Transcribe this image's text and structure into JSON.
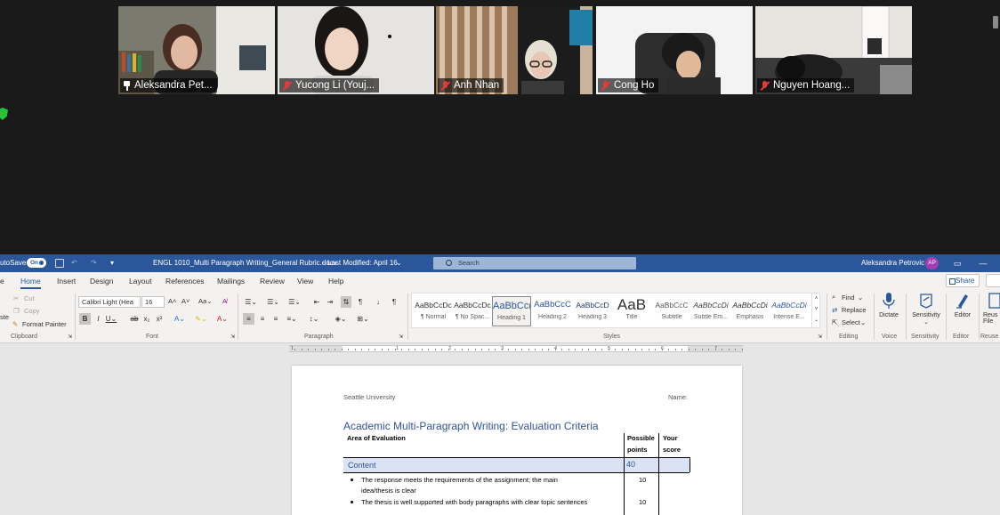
{
  "zoom": {
    "participants": [
      {
        "name": "Aleksandra Pet...",
        "muted": false,
        "pinned": true,
        "active": true
      },
      {
        "name": "Yucong Li (Youj...",
        "muted": true,
        "pinned": false,
        "active": false
      },
      {
        "name": "Anh Nhan",
        "muted": true,
        "pinned": false,
        "active": false
      },
      {
        "name": "Cong Ho",
        "muted": true,
        "pinned": false,
        "active": false
      },
      {
        "name": "Nguyen Hoang...",
        "muted": true,
        "pinned": false,
        "active": false
      }
    ],
    "accent_color": "#a4d65e",
    "shield_color": "#27c33a"
  },
  "word": {
    "titlebar": {
      "autosave_label": "utoSave",
      "autosave_state": "On",
      "filename": "ENGL 1010_Multi Paragraph Writing_General Rubric.docx",
      "modified": "Last Modified: April 16",
      "search_placeholder": "Search",
      "user_name": "Aleksandra Petrovic",
      "user_initials": "AP",
      "color": "#2b579a"
    },
    "tabs": [
      "e",
      "Home",
      "Insert",
      "Design",
      "Layout",
      "References",
      "Mailings",
      "Review",
      "View",
      "Help"
    ],
    "active_tab": "Home",
    "share_label": "Share",
    "clipboard": {
      "paste_label": "ste",
      "cut": "Cut",
      "copy": "Copy",
      "format_painter": "Format Painter",
      "group_label": "Clipboard"
    },
    "font": {
      "family": "Calibri Light (Hea",
      "size": "16",
      "group_label": "Font"
    },
    "paragraph": {
      "group_label": "Paragraph"
    },
    "styles": {
      "items": [
        {
          "preview": "AaBbCcDc",
          "name": "¶ Normal"
        },
        {
          "preview": "AaBbCcDc",
          "name": "¶ No Spac..."
        },
        {
          "preview": "AaBbCc(",
          "name": "Heading 1"
        },
        {
          "preview": "AaBbCcC",
          "name": "Heading 2"
        },
        {
          "preview": "AaBbCcD",
          "name": "Heading 3"
        },
        {
          "preview": "AaB",
          "name": "Title"
        },
        {
          "preview": "AaBbCcC",
          "name": "Subtitle"
        },
        {
          "preview": "AaBbCcDi",
          "name": "Subtle Em..."
        },
        {
          "preview": "AaBbCcDi",
          "name": "Emphasis"
        },
        {
          "preview": "AaBbCcDi",
          "name": "Intense E..."
        }
      ],
      "selected": "Heading 1",
      "group_label": "Styles"
    },
    "editing": {
      "find": "Find",
      "replace": "Replace",
      "select": "Select",
      "group_label": "Editing"
    },
    "voice": {
      "dictate": "Dictate",
      "group_label": "Voice"
    },
    "sensitivity": {
      "label": "Sensitivity",
      "group_label": "Sensitivity"
    },
    "editor": {
      "label": "Editor",
      "group_label": "Editor"
    },
    "reuse": {
      "label": "Reus",
      "label2": "File",
      "group_label": "Reuse"
    },
    "ruler_numbers": [
      "1",
      "1",
      "2",
      "3",
      "4",
      "5",
      "6",
      "7"
    ]
  },
  "document": {
    "header_left": "Seattle University",
    "header_right": "Name:",
    "title": "Academic Multi-Paragraph Writing: Evaluation Criteria",
    "table": {
      "col1_header": "Area of Evaluation",
      "col2_header_line1": "Possible",
      "col2_header_line2": "points",
      "col3_header_line1": "Your",
      "col3_header_line2": "score",
      "section": "Content",
      "section_points": "40",
      "rows": [
        {
          "text_line1": "The response meets the requirements of the assignment; the main",
          "text_line2": "idea/thesis is clear",
          "points": "10"
        },
        {
          "text_line1": "The thesis is well supported with body paragraphs with clear topic sentences",
          "text_line2": "",
          "points": "10"
        }
      ]
    },
    "section_color": "#dae3f3",
    "title_color": "#2f5597"
  }
}
